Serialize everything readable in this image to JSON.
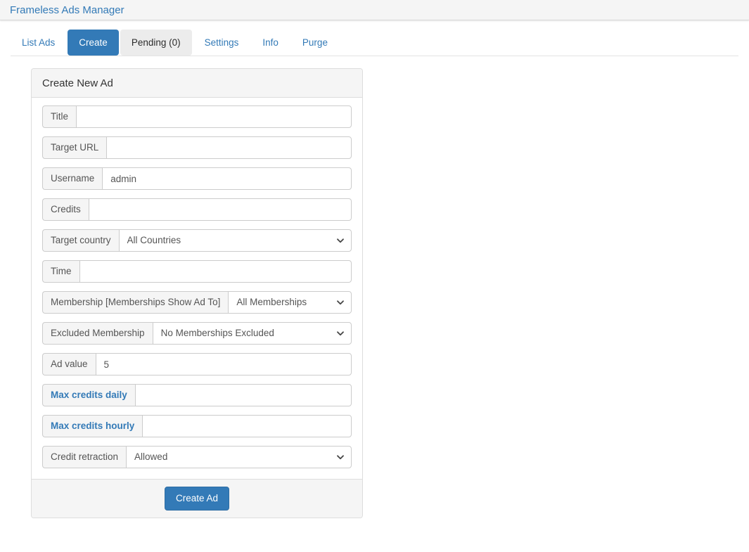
{
  "app": {
    "title": "Frameless Ads Manager"
  },
  "nav": {
    "tabs": [
      {
        "label": "List Ads",
        "state": "link"
      },
      {
        "label": "Create",
        "state": "active"
      },
      {
        "label": "Pending (0)",
        "state": "current"
      },
      {
        "label": "Settings",
        "state": "link"
      },
      {
        "label": "Info",
        "state": "link"
      },
      {
        "label": "Purge",
        "state": "link"
      }
    ]
  },
  "panel": {
    "heading": "Create New Ad",
    "fields": [
      {
        "label": "Title",
        "type": "text",
        "value": "",
        "placeholder": ""
      },
      {
        "label": "Target URL",
        "type": "text",
        "value": "",
        "placeholder": ""
      },
      {
        "label": "Username",
        "type": "text",
        "value": "admin",
        "placeholder": ""
      },
      {
        "label": "Credits",
        "type": "text",
        "value": "",
        "placeholder": ""
      },
      {
        "label": "Target country",
        "type": "select",
        "value": "All Countries"
      },
      {
        "label": "Time",
        "type": "text",
        "value": "",
        "placeholder": ""
      },
      {
        "label": "Membership [Memberships Show Ad To]",
        "type": "select",
        "value": "All Memberships"
      },
      {
        "label": "Excluded Membership",
        "type": "select",
        "value": "No Memberships Excluded"
      },
      {
        "label": "Ad value",
        "type": "text",
        "value": "5",
        "placeholder": ""
      },
      {
        "label": "Max credits daily",
        "type": "text",
        "value": "",
        "placeholder": "",
        "emphasis": true
      },
      {
        "label": "Max credits hourly",
        "type": "text",
        "value": "",
        "placeholder": "",
        "emphasis": true
      },
      {
        "label": "Credit retraction",
        "type": "select",
        "value": "Allowed"
      }
    ],
    "submit_label": "Create Ad"
  },
  "colors": {
    "brand_blue": "#337ab7",
    "panel_border": "#dddddd",
    "addon_bg": "#f5f5f5",
    "text": "#555555"
  }
}
